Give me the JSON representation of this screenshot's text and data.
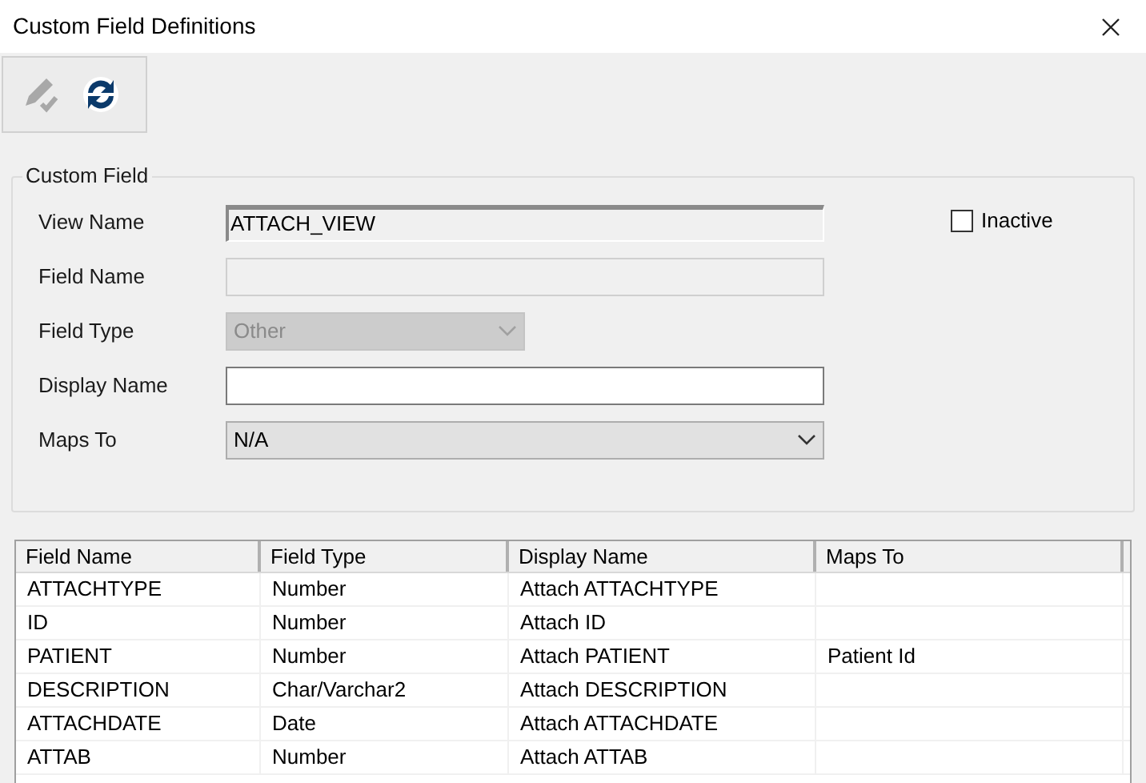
{
  "window": {
    "title": "Custom Field Definitions"
  },
  "toolbar": [
    {
      "kind": "edit",
      "disabled": true
    },
    {
      "kind": "refresh",
      "disabled": false
    }
  ],
  "group": {
    "title": "Custom Field",
    "fields": [
      {
        "label": "View Name",
        "kind": "readonly",
        "value": "ATTACH_VIEW"
      },
      {
        "label": "Field Name",
        "kind": "text",
        "disabled": true
      },
      {
        "label": "Field Type",
        "kind": "select",
        "value": "Other",
        "disabled": true
      },
      {
        "label": "Display Name",
        "kind": "text",
        "disabled": false
      },
      {
        "label": "Maps To",
        "kind": "select",
        "value": "N/A",
        "disabled": false
      }
    ],
    "inactive": {
      "label": "Inactive",
      "checked": false
    }
  },
  "table": {
    "columns": [
      "Field Name",
      "Field Type",
      "Display Name",
      "Maps To"
    ],
    "rows": [
      [
        "ATTACHTYPE",
        "Number",
        "Attach ATTACHTYPE",
        ""
      ],
      [
        "ID",
        "Number",
        "Attach ID",
        ""
      ],
      [
        "PATIENT",
        "Number",
        "Attach PATIENT",
        "Patient Id"
      ],
      [
        "DESCRIPTION",
        "Char/Varchar2",
        "Attach DESCRIPTION",
        ""
      ],
      [
        "ATTACHDATE",
        "Date",
        "Attach ATTACHDATE",
        ""
      ],
      [
        "ATTAB",
        "Number",
        "Attach ATTAB",
        ""
      ]
    ]
  }
}
